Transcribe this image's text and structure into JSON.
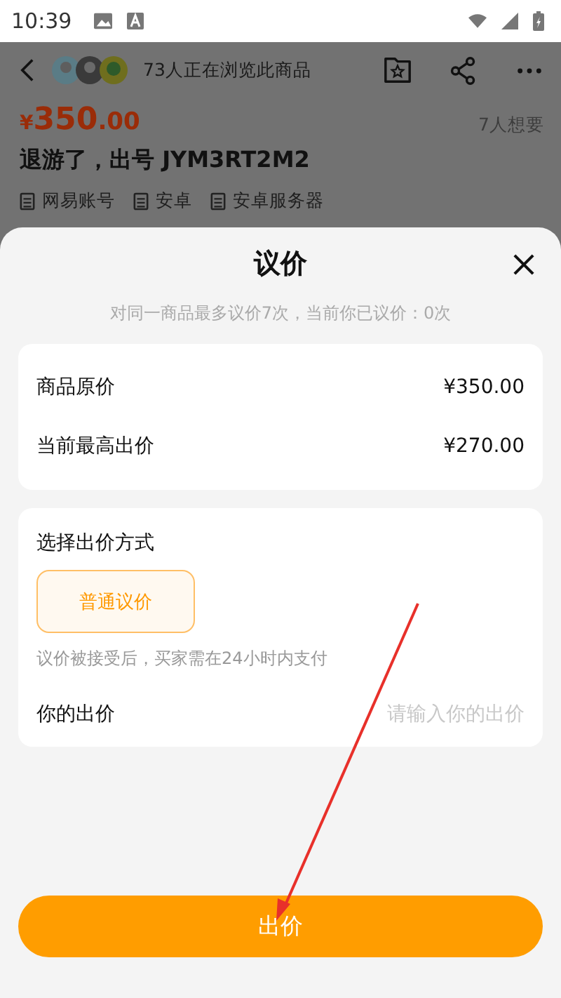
{
  "status_bar": {
    "time": "10:39"
  },
  "page": {
    "viewers": "73人正在浏览此商品",
    "price_symbol": "¥",
    "price_integer": "350",
    "price_decimal": ".00",
    "wants": "7人想要",
    "title": "退游了，出号 JYM3RT2M2",
    "tags": [
      "网易账号",
      "安卓",
      "安卓服务器"
    ]
  },
  "dialog": {
    "title": "议价",
    "note": "对同一商品最多议价7次，当前你已议价：0次",
    "prices": [
      {
        "label": "商品原价",
        "value": "¥350.00"
      },
      {
        "label": "当前最高出价",
        "value": "¥270.00"
      }
    ],
    "method": {
      "label": "选择出价方式",
      "options": [
        {
          "label": "普通议价",
          "selected": true
        }
      ],
      "hint": "议价被接受后，买家需在24小时内支付"
    },
    "offer": {
      "label": "你的出价",
      "placeholder": "请输入你的出价"
    },
    "submit": "出价"
  }
}
